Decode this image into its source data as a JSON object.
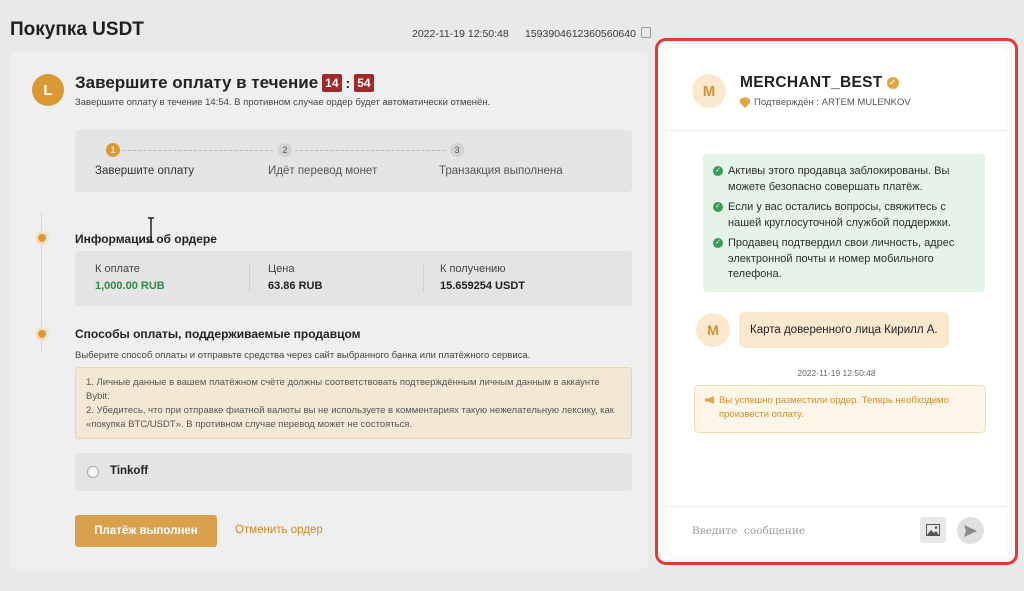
{
  "header": {
    "title": "Покупка USDT",
    "date": "2022-11-19 12:50:48",
    "order_id": "1593904612360560640"
  },
  "payment": {
    "avatar_letter": "L",
    "heading": "Завершите оплату в течение",
    "timer_minutes": "14",
    "timer_separator": ":",
    "timer_seconds": "54",
    "subtitle": "Завершите оплату в течение 14:54. В противном случае ордер будет автоматически отменён."
  },
  "steps": [
    {
      "num": "1",
      "label": "Завершите оплату"
    },
    {
      "num": "2",
      "label": "Идёт перевод монет"
    },
    {
      "num": "3",
      "label": "Транзакция выполнена"
    }
  ],
  "order_info": {
    "title": "Информация об ордере",
    "columns": [
      {
        "label": "К оплате",
        "value": "1,000.00 RUB"
      },
      {
        "label": "Цена",
        "value": "63.86 RUB"
      },
      {
        "label": "К получению",
        "value": "15.659254 USDT"
      }
    ]
  },
  "methods": {
    "title": "Способы оплаты, поддерживаемые продавцом",
    "subtitle": "Выберите способ оплаты и отправьте средства через сайт выбранного банка или платёжного сервиса.",
    "warning_1": "1. Личные данные в вашем платёжном счёте должны соответствовать подтверждённым личным данным в аккаунте Bybit.",
    "warning_2": "2. Убедитесь, что при отправке фиатной валюты вы не используете в комментариях такую нежелательную лексику, как «покупка BTC/USDT». В противном случае перевод может не состояться.",
    "option": "Tinkoff"
  },
  "actions": {
    "paid": "Платёж выполнен",
    "cancel": "Отменить ордер"
  },
  "chat": {
    "merchant_name": "MERCHANT_BEST",
    "merchant_avatar": "M",
    "verified": "Подтверждён : ARTEM MULENKOV",
    "safety": [
      "Активы этого продавца заблокированы. Вы можете безопасно совершать платёж.",
      "Если у вас остались вопросы, свяжитесь с нашей круглосуточной службой поддержки.",
      "Продавец подтвердил свои личность, адрес электронной почты и номер мобильного телефона."
    ],
    "message_avatar": "M",
    "message": "Карта доверенного лица Кирилл А.",
    "time": "2022-11-19 12:50:48",
    "system_message": "Вы успешно разместили ордер. Теперь необходимо произвести оплату.",
    "input_placeholder": "Введите  сообщение"
  },
  "colors": {
    "accent": "#d99a35",
    "timer": "#a12929",
    "highlight_frame": "#e53935",
    "success_green": "#2f8a45"
  }
}
